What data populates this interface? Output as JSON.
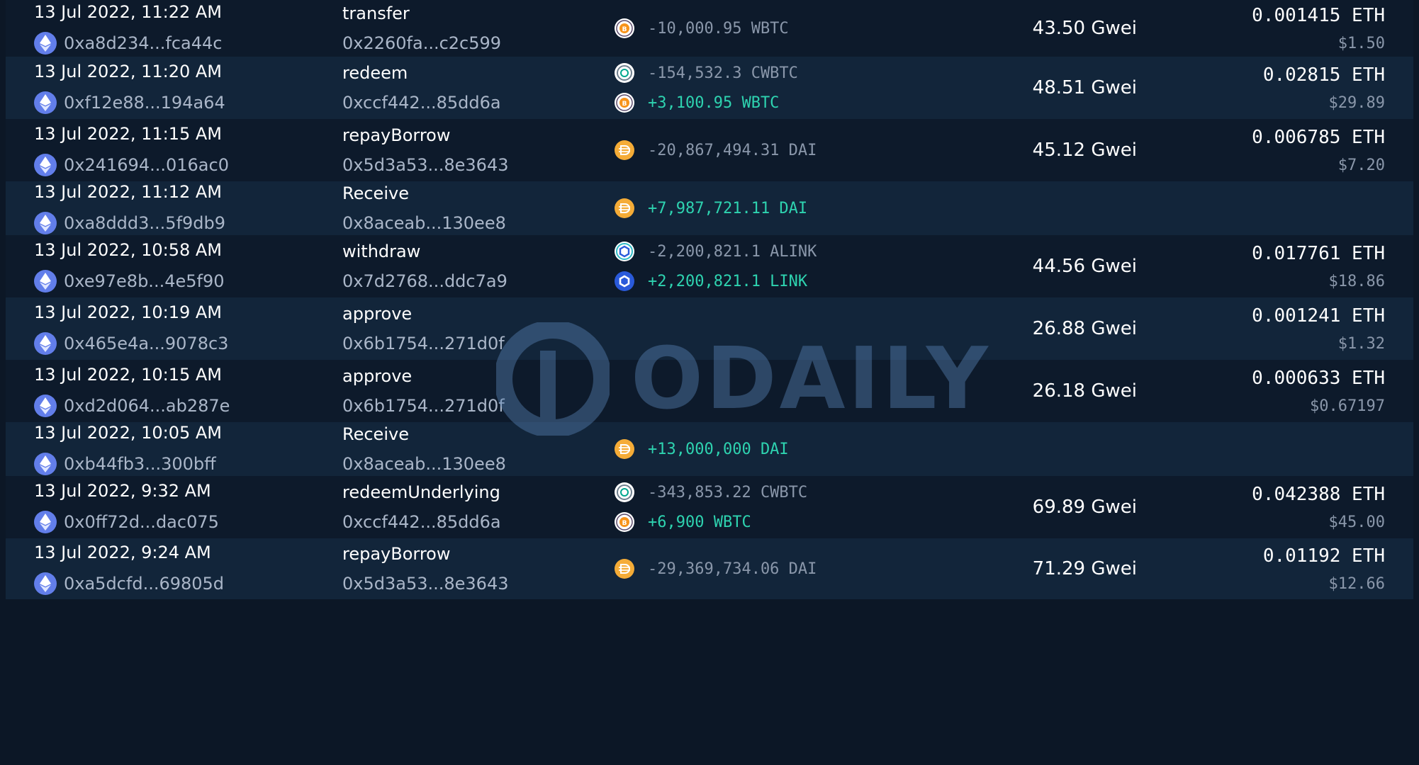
{
  "colors": {
    "background": "#0c1726",
    "row_even": "#12253a",
    "row_odd": "#0d1a2b",
    "positive": "#2ed3b0",
    "negative": "#8a97aa",
    "eth": "#627eea",
    "btc": "#f7931a",
    "dai": "#f5ac37",
    "link": "#2a5ada"
  },
  "watermark": {
    "text": "ODAILY",
    "icon": "odaily-logo-icon"
  },
  "transactions": [
    {
      "time": "13 Jul 2022, 11:22 AM",
      "from": "0xa8d234...fca44c",
      "method": "transfer",
      "to": "0x2260fa...c2c599",
      "transfers": [
        {
          "icon": "wbtc-icon",
          "amount": "-10,000.95 WBTC",
          "direction": "out"
        }
      ],
      "gas": "43.50 Gwei",
      "fee_eth": "0.001415 ETH",
      "fee_usd": "$1.50"
    },
    {
      "time": "13 Jul 2022, 11:20 AM",
      "from": "0xf12e88...194a64",
      "method": "redeem",
      "to": "0xccf442...85dd6a",
      "transfers": [
        {
          "icon": "cwbtc-icon",
          "amount": "-154,532.3 CWBTC",
          "direction": "out"
        },
        {
          "icon": "wbtc-icon",
          "amount": "+3,100.95 WBTC",
          "direction": "in"
        }
      ],
      "gas": "48.51 Gwei",
      "fee_eth": "0.02815 ETH",
      "fee_usd": "$29.89"
    },
    {
      "time": "13 Jul 2022, 11:15 AM",
      "from": "0x241694...016ac0",
      "method": "repayBorrow",
      "to": "0x5d3a53...8e3643",
      "transfers": [
        {
          "icon": "dai-icon",
          "amount": "-20,867,494.31 DAI",
          "direction": "out"
        }
      ],
      "gas": "45.12 Gwei",
      "fee_eth": "0.006785 ETH",
      "fee_usd": "$7.20"
    },
    {
      "time": "13 Jul 2022, 11:12 AM",
      "from": "0xa8ddd3...5f9db9",
      "method": "Receive",
      "to": "0x8aceab...130ee8",
      "transfers": [
        {
          "icon": "dai-icon",
          "amount": "+7,987,721.11 DAI",
          "direction": "in"
        }
      ],
      "gas": "",
      "fee_eth": "",
      "fee_usd": ""
    },
    {
      "time": "13 Jul 2022, 10:58 AM",
      "from": "0xe97e8b...4e5f90",
      "method": "withdraw",
      "to": "0x7d2768...ddc7a9",
      "transfers": [
        {
          "icon": "alink-icon",
          "amount": "-2,200,821.1 ALINK",
          "direction": "out"
        },
        {
          "icon": "link-icon",
          "amount": "+2,200,821.1 LINK",
          "direction": "in"
        }
      ],
      "gas": "44.56 Gwei",
      "fee_eth": "0.017761 ETH",
      "fee_usd": "$18.86"
    },
    {
      "time": "13 Jul 2022, 10:19 AM",
      "from": "0x465e4a...9078c3",
      "method": "approve",
      "to": "0x6b1754...271d0f",
      "transfers": [],
      "gas": "26.88 Gwei",
      "fee_eth": "0.001241 ETH",
      "fee_usd": "$1.32"
    },
    {
      "time": "13 Jul 2022, 10:15 AM",
      "from": "0xd2d064...ab287e",
      "method": "approve",
      "to": "0x6b1754...271d0f",
      "transfers": [],
      "gas": "26.18 Gwei",
      "fee_eth": "0.000633 ETH",
      "fee_usd": "$0.67197"
    },
    {
      "time": "13 Jul 2022, 10:05 AM",
      "from": "0xb44fb3...300bff",
      "method": "Receive",
      "to": "0x8aceab...130ee8",
      "transfers": [
        {
          "icon": "dai-icon",
          "amount": "+13,000,000 DAI",
          "direction": "in"
        }
      ],
      "gas": "",
      "fee_eth": "",
      "fee_usd": ""
    },
    {
      "time": "13 Jul 2022, 9:32 AM",
      "from": "0x0ff72d...dac075",
      "method": "redeemUnderlying",
      "to": "0xccf442...85dd6a",
      "transfers": [
        {
          "icon": "cwbtc-icon",
          "amount": "-343,853.22 CWBTC",
          "direction": "out"
        },
        {
          "icon": "wbtc-icon",
          "amount": "+6,900 WBTC",
          "direction": "in"
        }
      ],
      "gas": "69.89 Gwei",
      "fee_eth": "0.042388 ETH",
      "fee_usd": "$45.00"
    },
    {
      "time": "13 Jul 2022, 9:24 AM",
      "from": "0xa5dcfd...69805d",
      "method": "repayBorrow",
      "to": "0x5d3a53...8e3643",
      "transfers": [
        {
          "icon": "dai-icon",
          "amount": "-29,369,734.06 DAI",
          "direction": "out"
        }
      ],
      "gas": "71.29 Gwei",
      "fee_eth": "0.01192 ETH",
      "fee_usd": "$12.66"
    }
  ]
}
